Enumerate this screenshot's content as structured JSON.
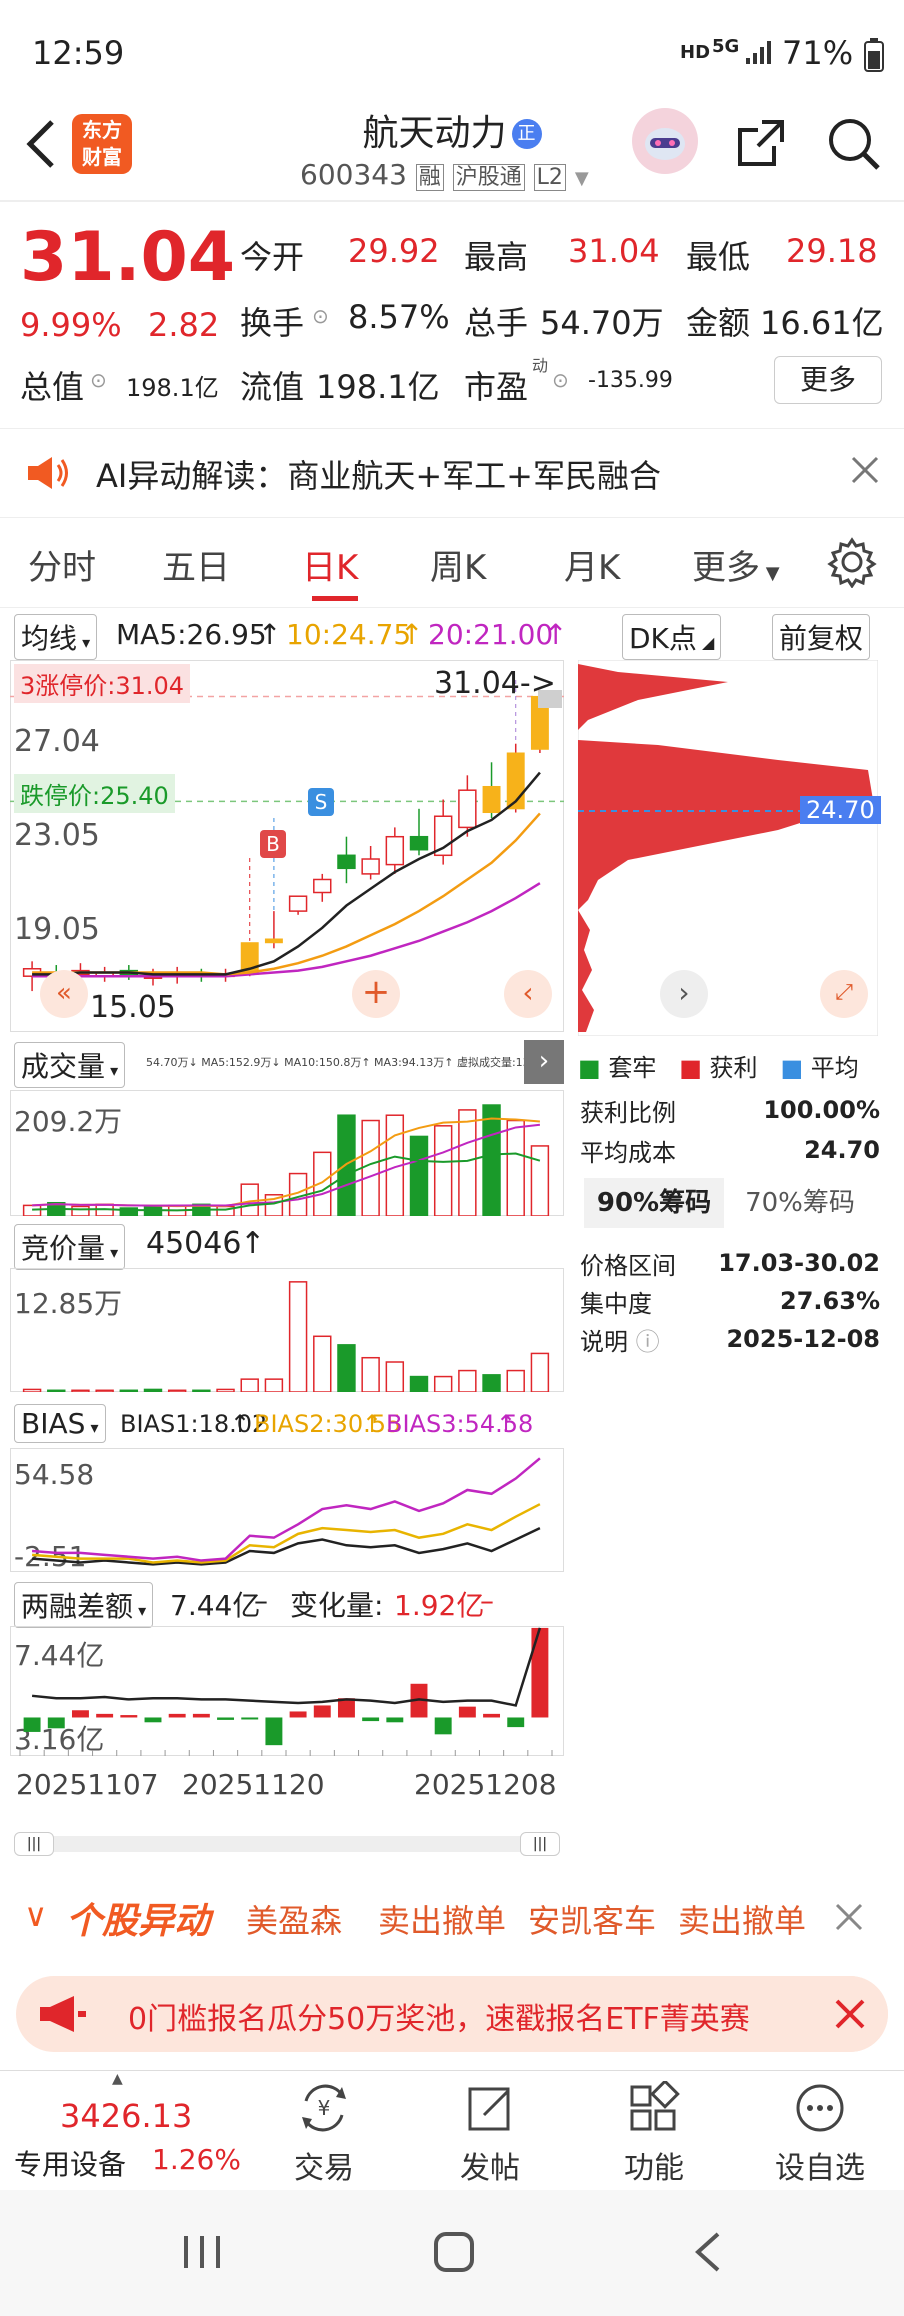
{
  "status": {
    "time": "12:59",
    "net": "HD",
    "net2": "5G",
    "battery": "71%"
  },
  "header": {
    "title": "航天动力",
    "title_badge": "正",
    "code": "600343",
    "tag1": "融",
    "tag2": "沪股通",
    "tag3": "L2",
    "logo_line1": "东方",
    "logo_line2": "财富"
  },
  "quote": {
    "price": "31.04",
    "pct": "9.99%",
    "change": "2.82",
    "open_label": "今开",
    "open": "29.92",
    "high_label": "最高",
    "high": "31.04",
    "low_label": "最低",
    "low": "29.18",
    "turnover_label": "换手",
    "turnover": "8.57%",
    "volume_label": "总手",
    "volume": "54.70万",
    "amount_label": "金额",
    "amount": "16.61亿",
    "mktcap_label": "总值",
    "mktcap": "198.1亿",
    "float_label": "流值",
    "float": "198.1亿",
    "pe_label": "市盈",
    "pe_sup": "动",
    "pe": "-135.99",
    "more": "更多"
  },
  "ai": {
    "text": "AI异动解读：商业航天+军工+军民融合"
  },
  "tabs": [
    "分时",
    "五日",
    "日K",
    "周K",
    "月K",
    "更多"
  ],
  "kline": {
    "ma_select": "均线",
    "ma5": "MA5:26.95",
    "ma10": "10:24.75",
    "ma20": "20:21.00",
    "dk": "DK点",
    "fq": "前复权",
    "limit_up": "涨停价:31.04",
    "limit_up_prefix": "3",
    "limit_down": "跌停价:25.40",
    "y1": "27.04",
    "y2": "23.05",
    "y3": "19.05",
    "low_mark": "15.05",
    "high_mark": "31.04->",
    "b_label": "B",
    "s_label": "S",
    "cost_tag": "24.70"
  },
  "chip": {
    "legend": [
      "套牢",
      "获利",
      "平均"
    ],
    "rows": [
      {
        "k": "获利比例",
        "v": "100.00%"
      },
      {
        "k": "平均成本",
        "v": "24.70"
      }
    ],
    "tab1": "90%筹码",
    "tab2": "70%筹码",
    "rows2": [
      {
        "k": "价格区间",
        "v": "17.03-30.02"
      },
      {
        "k": "集中度",
        "v": "27.63%"
      },
      {
        "k": "说明",
        "v": "2025-12-08"
      }
    ]
  },
  "volume": {
    "select": "成交量",
    "max": "209.2万",
    "legend": "54.70万↓ MA5:152.9万↓ MA10:150.8万↑ MA3:94.13万↑ 虚拟成交量:132.1万"
  },
  "auction": {
    "select": "竞价量",
    "value": "45046",
    "max": "12.85万"
  },
  "bias": {
    "select": "BIAS",
    "b1": "BIAS1:18.02",
    "b2": "BIAS2:30.55",
    "b3": "BIAS3:54.58",
    "top": "54.58",
    "bottom": "-2.51"
  },
  "margin": {
    "select": "两融差额",
    "value": "7.44亿",
    "change_label": "变化量:",
    "change": "1.92亿",
    "top": "7.44亿",
    "bottom": "3.16亿"
  },
  "dates": [
    "20251107",
    "20251120",
    "20251208"
  ],
  "ticker": {
    "label": "个股异动",
    "items": [
      "美盈森",
      "卖出撤单",
      "安凯客车",
      "卖出撤单"
    ]
  },
  "promo": {
    "text": "0门槛报名瓜分50万奖池，速戳报名ETF菁英赛"
  },
  "nav": {
    "index_value": "3426.13",
    "index_name": "专用设备",
    "index_pct": "1.26%",
    "items": [
      "交易",
      "发帖",
      "功能",
      "设自选"
    ]
  },
  "colors": {
    "red": "#e0262b",
    "green": "#1a9a2a",
    "orange": "#f39c12",
    "purple": "#c026c0",
    "black": "#222222"
  },
  "chart_data": [
    {
      "type": "candlestick",
      "ylim": [
        13,
        33
      ],
      "candles": [
        {
          "o": 16.0,
          "c": 16.4,
          "h": 16.8,
          "l": 15.2
        },
        {
          "o": 16.2,
          "c": 16.0,
          "h": 16.6,
          "l": 15.6
        },
        {
          "o": 16.1,
          "c": 16.3,
          "h": 16.7,
          "l": 15.8
        },
        {
          "o": 16.0,
          "c": 16.2,
          "h": 16.5,
          "l": 15.7
        },
        {
          "o": 16.3,
          "c": 16.1,
          "h": 16.6,
          "l": 15.8
        },
        {
          "o": 15.9,
          "c": 16.0,
          "h": 16.4,
          "l": 15.5
        },
        {
          "o": 16.0,
          "c": 16.2,
          "h": 16.5,
          "l": 15.6
        },
        {
          "o": 16.1,
          "c": 16.0,
          "h": 16.4,
          "l": 15.7
        },
        {
          "o": 16.0,
          "c": 16.1,
          "h": 16.4,
          "l": 15.7
        },
        {
          "o": 16.1,
          "c": 17.8,
          "h": 17.8,
          "l": 16.0
        },
        {
          "o": 17.8,
          "c": 18.0,
          "h": 19.5,
          "l": 17.5
        },
        {
          "o": 19.5,
          "c": 20.3,
          "h": 20.3,
          "l": 19.3
        },
        {
          "o": 20.5,
          "c": 21.2,
          "h": 21.5,
          "l": 20.0
        },
        {
          "o": 22.5,
          "c": 21.8,
          "h": 23.5,
          "l": 21.0
        },
        {
          "o": 21.5,
          "c": 22.3,
          "h": 23.0,
          "l": 21.2
        },
        {
          "o": 22.0,
          "c": 23.5,
          "h": 24.0,
          "l": 21.5
        },
        {
          "o": 23.5,
          "c": 22.8,
          "h": 25.0,
          "l": 22.5
        },
        {
          "o": 22.5,
          "c": 24.6,
          "h": 25.5,
          "l": 22.0
        },
        {
          "o": 24.0,
          "c": 26.0,
          "h": 26.8,
          "l": 23.5
        },
        {
          "o": 26.2,
          "c": 24.8,
          "h": 27.5,
          "l": 24.5
        },
        {
          "o": 25.0,
          "c": 28.0,
          "h": 28.5,
          "l": 24.8
        },
        {
          "o": 28.2,
          "c": 31.04,
          "h": 31.04,
          "l": 28.0
        }
      ],
      "ma5": [
        16.1,
        16.1,
        16.2,
        16.2,
        16.2,
        16.1,
        16.1,
        16.1,
        16.1,
        16.4,
        16.8,
        17.6,
        18.6,
        19.8,
        20.7,
        21.6,
        22.3,
        22.9,
        23.8,
        24.4,
        25.4,
        26.95
      ],
      "ma10": [
        16.2,
        16.2,
        16.2,
        16.2,
        16.2,
        16.2,
        16.2,
        16.2,
        16.1,
        16.2,
        16.4,
        16.7,
        17.1,
        17.6,
        18.2,
        18.8,
        19.5,
        20.3,
        21.2,
        22.1,
        23.3,
        24.75
      ],
      "ma20": [
        16.0,
        16.0,
        16.0,
        16.0,
        16.0,
        16.0,
        16.0,
        16.0,
        16.0,
        16.1,
        16.2,
        16.3,
        16.5,
        16.8,
        17.1,
        17.5,
        17.9,
        18.4,
        18.9,
        19.5,
        20.2,
        21.0
      ]
    },
    {
      "type": "bar",
      "name": "volume",
      "ylim": [
        0,
        230
      ],
      "values": [
        20,
        25,
        18,
        22,
        15,
        18,
        20,
        22,
        18,
        60,
        40,
        80,
        120,
        190,
        180,
        190,
        150,
        170,
        200,
        209.2,
        180,
        132.1
      ],
      "up": [
        true,
        false,
        true,
        true,
        false,
        false,
        true,
        false,
        true,
        true,
        true,
        true,
        true,
        false,
        true,
        true,
        false,
        true,
        true,
        false,
        true,
        true
      ]
    },
    {
      "type": "bar",
      "name": "auction",
      "ylim": [
        0,
        14
      ],
      "values": [
        0.3,
        0.2,
        0.2,
        0.2,
        0.2,
        0.3,
        0.2,
        0.2,
        0.3,
        1.5,
        1.5,
        12.85,
        6.5,
        5.5,
        4.0,
        3.5,
        1.8,
        1.8,
        2.5,
        2.0,
        2.5,
        4.5
      ],
      "up": [
        true,
        false,
        true,
        true,
        false,
        false,
        true,
        false,
        true,
        true,
        true,
        true,
        true,
        false,
        true,
        true,
        false,
        true,
        true,
        false,
        true,
        true
      ]
    },
    {
      "type": "line",
      "name": "bias",
      "ylim": [
        -5,
        60
      ],
      "series": [
        {
          "name": "BIAS1",
          "values": [
            2,
            1,
            0,
            1,
            0,
            -1,
            0,
            -1,
            0,
            6,
            5,
            10,
            12,
            9,
            8,
            9,
            5,
            7,
            10,
            6,
            12,
            18.02
          ]
        },
        {
          "name": "BIAS2",
          "values": [
            4,
            3,
            2,
            2,
            2,
            0,
            1,
            0,
            1,
            9,
            8,
            15,
            18,
            17,
            16,
            17,
            13,
            15,
            20,
            17,
            24,
            30.55
          ]
        },
        {
          "name": "BIAS3",
          "values": [
            6,
            5,
            5,
            4,
            3,
            2,
            3,
            1,
            2,
            14,
            13,
            20,
            28,
            30,
            28,
            32,
            27,
            31,
            38,
            36,
            44,
            54.58
          ]
        }
      ]
    },
    {
      "type": "bar",
      "name": "margin",
      "ylim": [
        -3.2,
        7.6
      ],
      "zero": 0,
      "values": [
        -1.2,
        -0.9,
        0.6,
        0.3,
        0.2,
        -0.4,
        0.3,
        0.3,
        -0.2,
        -0.1,
        -2.3,
        0.5,
        1.0,
        1.6,
        -0.3,
        -0.4,
        2.8,
        -1.4,
        0.9,
        0.3,
        -0.8,
        7.44
      ],
      "line": [
        1.8,
        1.6,
        1.6,
        1.7,
        1.5,
        1.6,
        1.6,
        1.5,
        1.5,
        1.4,
        1.3,
        1.2,
        1.3,
        1.5,
        1.4,
        1.2,
        1.5,
        1.3,
        1.4,
        1.4,
        1.0,
        7.44
      ]
    }
  ]
}
